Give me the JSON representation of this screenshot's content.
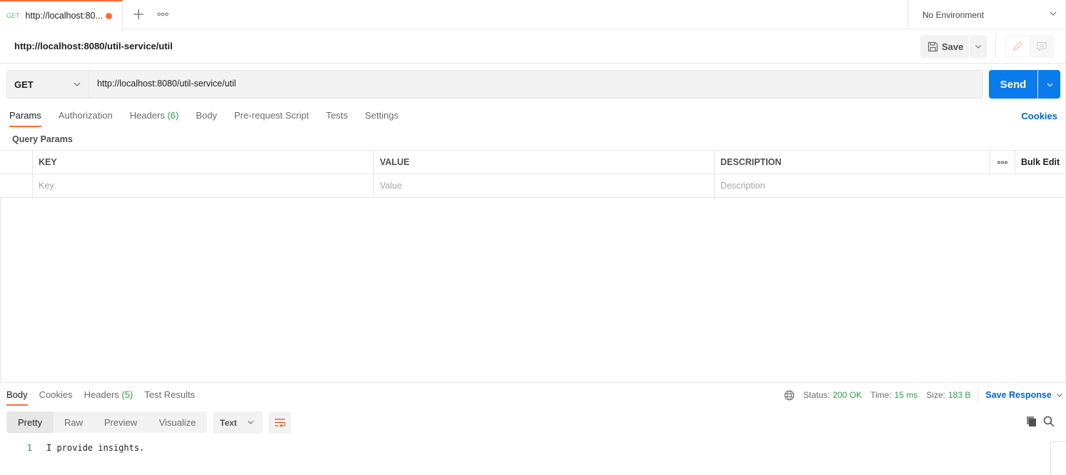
{
  "tabbar": {
    "active_tab": {
      "method": "GET",
      "title": "http://localhost:80...",
      "unsaved": true
    },
    "new_tab_icon": "plus-icon",
    "more_icon": "more-horizontal-icon",
    "environment": "No Environment"
  },
  "request": {
    "name": "http://localhost:8080/util-service/util",
    "save_label": "Save",
    "method": "GET",
    "url": "http://localhost:8080/util-service/util",
    "send_label": "Send",
    "tabs": [
      {
        "label": "Params",
        "active": true
      },
      {
        "label": "Authorization"
      },
      {
        "label": "Headers",
        "count": "(6)"
      },
      {
        "label": "Body"
      },
      {
        "label": "Pre-request Script"
      },
      {
        "label": "Tests"
      },
      {
        "label": "Settings"
      }
    ],
    "cookies_label": "Cookies",
    "query_params_label": "Query Params",
    "params_table": {
      "headers": [
        "KEY",
        "VALUE",
        "DESCRIPTION"
      ],
      "bulk_edit_label": "Bulk Edit",
      "placeholders": {
        "key": "Key",
        "value": "Value",
        "description": "Description"
      }
    }
  },
  "response": {
    "tabs": [
      {
        "label": "Body",
        "active": true
      },
      {
        "label": "Cookies"
      },
      {
        "label": "Headers",
        "count": "(5)"
      },
      {
        "label": "Test Results"
      }
    ],
    "status_label": "Status:",
    "status_value": "200 OK",
    "time_label": "Time:",
    "time_value": "15 ms",
    "size_label": "Size:",
    "size_value": "183 B",
    "save_response_label": "Save Response",
    "formats": [
      "Pretty",
      "Raw",
      "Preview",
      "Visualize"
    ],
    "active_format": "Pretty",
    "language": "Text",
    "lines": [
      {
        "number": "1",
        "text": "I provide insights."
      }
    ]
  },
  "colors": {
    "accent": "#ff6c37",
    "primary": "#097bed",
    "success": "#2e9f4a",
    "link": "#0265d2"
  }
}
